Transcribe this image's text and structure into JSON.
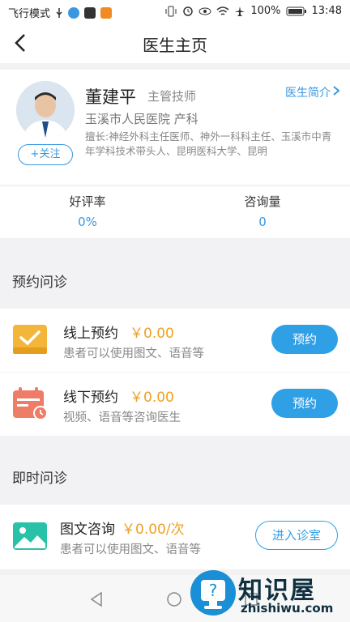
{
  "status_bar": {
    "left_text": "飞行模式",
    "battery": "100%",
    "time": "13:48"
  },
  "nav": {
    "title": "医生主页"
  },
  "doctor": {
    "name": "董建平",
    "title": "主管技师",
    "intro_link": "医生简介",
    "hospital": "玉溪市人民医院 产科",
    "expertise": "擅长:神经外科主任医师、神外一科科主任、玉溪市中青年学科技术带头人、昆明医科大学、昆明",
    "follow_label": "+关注"
  },
  "stats": {
    "rating_label": "好评率",
    "rating_value": "0%",
    "consult_label": "咨询量",
    "consult_value": "0"
  },
  "appointment_section": {
    "title": "预约问诊",
    "items": [
      {
        "title": "线上预约",
        "price": "￥0.00",
        "desc": "患者可以使用图文、语音等",
        "button": "预约",
        "icon": "checkbox-tray-icon"
      },
      {
        "title": "线下预约",
        "price": "￥0.00",
        "desc": "视频、语音等咨询医生",
        "button": "预约",
        "icon": "calendar-clock-icon"
      }
    ]
  },
  "instant_section": {
    "title": "即时问诊",
    "items": [
      {
        "title": "图文咨询",
        "price": "￥0.00/次",
        "desc": "患者可以使用图文、语音等",
        "button": "进入诊室",
        "icon": "picture-icon"
      }
    ]
  },
  "watermark": {
    "text": "知识屋",
    "sub": "zhishiwu.com"
  },
  "colors": {
    "accent": "#2f9fe6",
    "price": "#f0a020",
    "orange_icon": "#f4b63a",
    "red_icon": "#ee7c66",
    "teal_icon": "#27c2a7"
  }
}
